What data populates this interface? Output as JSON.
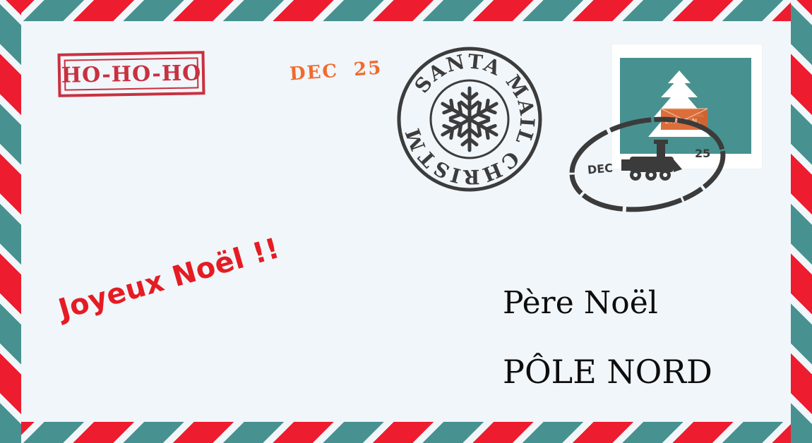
{
  "envelope": {
    "colors": {
      "red": "#ed1c2e",
      "green": "#479290",
      "paper": "#f1f6fa"
    },
    "stamp_hohoho": "HO-HO-HO",
    "date_stamp": "DEC  25",
    "postmark": {
      "ring_text": "SANTA MAIL CHRISTMAS",
      "icon": "snowflake-icon"
    },
    "postage_stamp": {
      "label": "L.A.P.N.",
      "icon": "christmas-tree-icon"
    },
    "cancellation": {
      "month": "DEC",
      "day": "25",
      "icon": "train-icon"
    },
    "greeting": "Joyeux Noël !!",
    "recipient_name": "Père Noël",
    "recipient_place": "PÔLE NORD"
  }
}
